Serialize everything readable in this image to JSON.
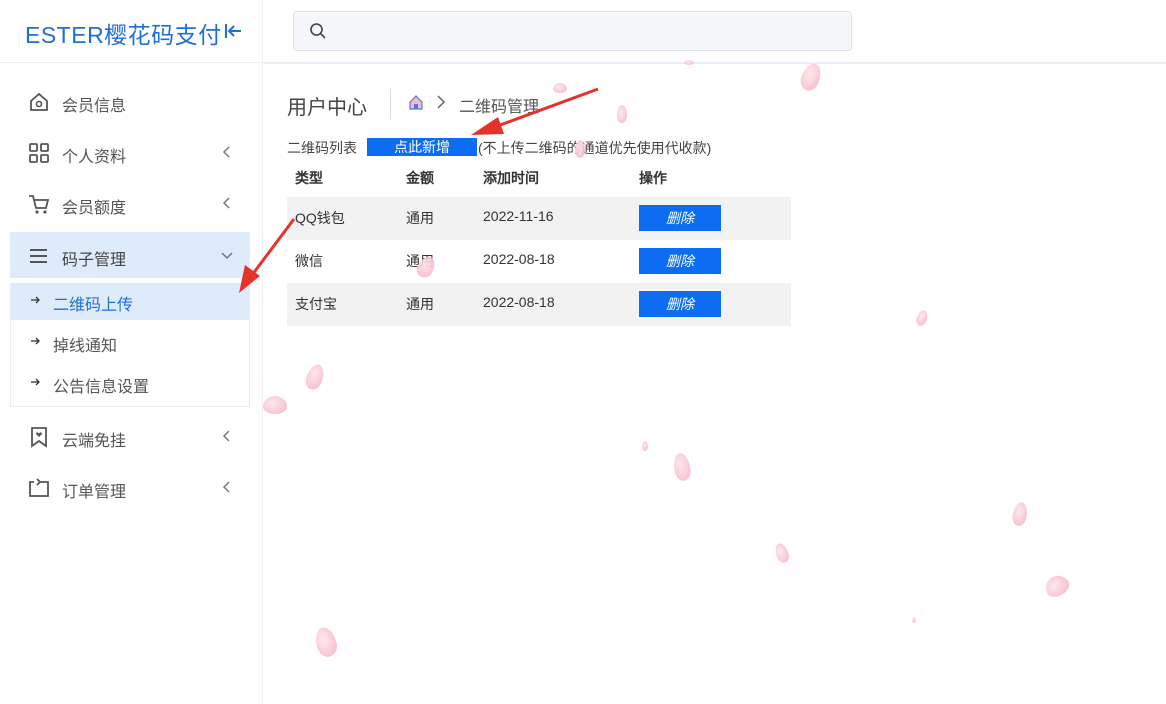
{
  "brand": {
    "title": "ESTER樱花码支付"
  },
  "sidebar": {
    "items": [
      {
        "label": "会员信息",
        "icon": "home-icon",
        "has_chevron": false
      },
      {
        "label": "个人资料",
        "icon": "grid-icon",
        "has_chevron": true
      },
      {
        "label": "会员额度",
        "icon": "cart-icon",
        "has_chevron": true
      },
      {
        "label": "码子管理",
        "icon": "menu-icon",
        "has_chevron": true,
        "expanded": true
      },
      {
        "label": "云端免挂",
        "icon": "bookmark-icon",
        "has_chevron": true
      },
      {
        "label": "订单管理",
        "icon": "transfer-icon",
        "has_chevron": true
      }
    ],
    "submenu": [
      {
        "label": "二维码上传",
        "active": true
      },
      {
        "label": "掉线通知",
        "active": false
      },
      {
        "label": "公告信息设置",
        "active": false
      }
    ]
  },
  "search": {
    "placeholder": ""
  },
  "page": {
    "title": "用户中心",
    "breadcrumb_current": "二维码管理",
    "list_label": "二维码列表",
    "add_label": "点此新增",
    "hint": "(不上传二维码的通道优先使用代收款)"
  },
  "table": {
    "headers": [
      "类型",
      "金额",
      "添加时间",
      "操作"
    ],
    "rows": [
      {
        "type": "QQ钱包",
        "amount": "通用",
        "date": "2022-11-16",
        "action": "删除"
      },
      {
        "type": "微信",
        "amount": "通用",
        "date": "2022-08-18",
        "action": "删除"
      },
      {
        "type": "支付宝",
        "amount": "通用",
        "date": "2022-08-18",
        "action": "删除"
      }
    ]
  },
  "colors": {
    "accent": "#1e6fd9",
    "button": "#0c6cf2",
    "active_bg": "#deebfa",
    "annotation_arrow": "#e8312b"
  }
}
